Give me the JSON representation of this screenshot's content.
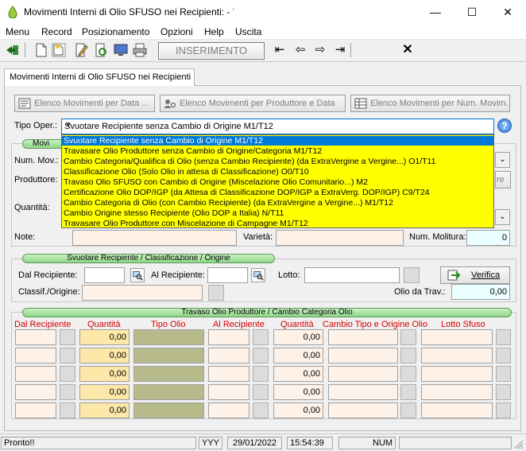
{
  "window": {
    "title": "Movimenti Interni di Olio SFUSO nei Recipienti: -",
    "title_suffix": "'",
    "controls": [
      "—",
      "☐",
      "✕"
    ]
  },
  "menu": [
    "Menu",
    "Record",
    "Posizionamento",
    "Opzioni",
    "Help",
    "Uscita"
  ],
  "toolbar": {
    "mode_label": "INSERIMENTO",
    "close": "✕"
  },
  "tab": {
    "label": "Movimenti Interni di Olio SFUSO nei Recipienti"
  },
  "buttons": {
    "elenco_movimenti": "Elenco Movimenti per Data ...",
    "elenco_produttore": "Elenco Movimenti per Produttore e Data",
    "elenco_num_movim": "Elenco Movimenti per Num. Movim."
  },
  "tipo_oper": {
    "label": "Tipo Oper.:",
    "value": "Svuotare Recipiente senza Cambio di Origine M1/T12",
    "options": [
      "Svuotare Recipiente senza Cambio di Origine M1/T12",
      "Travasare Olio Produttore senza Cambio di Origine/Categoria M1/T12",
      "Cambio Categoria/Qualifica di Olio (senza Cambio Recipiente) (da ExtraVergine a Vergine...) O1/T11",
      "Classificazione Olio (Solo Olio in attesa di Classificazione) O0/T10",
      "Travaso Olio SFUSO con Cambio di Origine (Miscelazione Olio Comunitario...) M2",
      "Certificazione Olio DOP/IGP (da Attesa di Classificazione DOP/IGP a ExtraVerg. DOP/IGP) C9/T24",
      "Cambio Categoria di Olio (con Cambio Recipiente) (da ExtraVergine a Vergine...) M1/T12",
      "Cambio Origine stesso Recipiente (Olio DOP a Italia) N/T11",
      "Travasare Olio Produttore con Miscelazione di Campagne M1/T12"
    ]
  },
  "movimento": {
    "header": "Movi",
    "num_mov_label": "Num. Mov.:",
    "produttore_label": "Produttore:",
    "quantita_label": "Quantità:",
    "produttore_btn_tail": "re",
    "note_label": "Note:",
    "varieta_label": "Varietà:",
    "num_molitura_label": "Num. Molitura:",
    "num_molitura_value": "0"
  },
  "svuotare": {
    "header": "Svuotare Recipiente / Classificazione / Origine",
    "dal_recipiente_label": "Dal Recipiente:",
    "al_recipiente_label": "Al Recipiente:",
    "lotto_label": "Lotto:",
    "verifica_label": "Verifica",
    "classif_label": "Classif./Origine:",
    "olio_da_trav_label": "Olio da Trav.:",
    "olio_da_trav_value": "0,00"
  },
  "travaso": {
    "header": "Travaso Olio Produttore / Cambio Categoria Olio",
    "columns": [
      "Dal Recipiente",
      "Quantità",
      "Tipo Olio",
      "Al Recipiente",
      "Quantità",
      "Cambio Tipo e Origine Olio",
      "Lotto Sfuso"
    ],
    "rows": [
      {
        "q1": "0,00",
        "q2": "0,00"
      },
      {
        "q1": "0,00",
        "q2": "0,00"
      },
      {
        "q1": "0,00",
        "q2": "0,00"
      },
      {
        "q1": "0,00",
        "q2": "0,00"
      },
      {
        "q1": "0,00",
        "q2": "0,00"
      }
    ]
  },
  "status": {
    "message": "Pronto!!",
    "year": "YYY",
    "date": "29/01/2022",
    "time": "15:54:39",
    "num": "NUM"
  }
}
